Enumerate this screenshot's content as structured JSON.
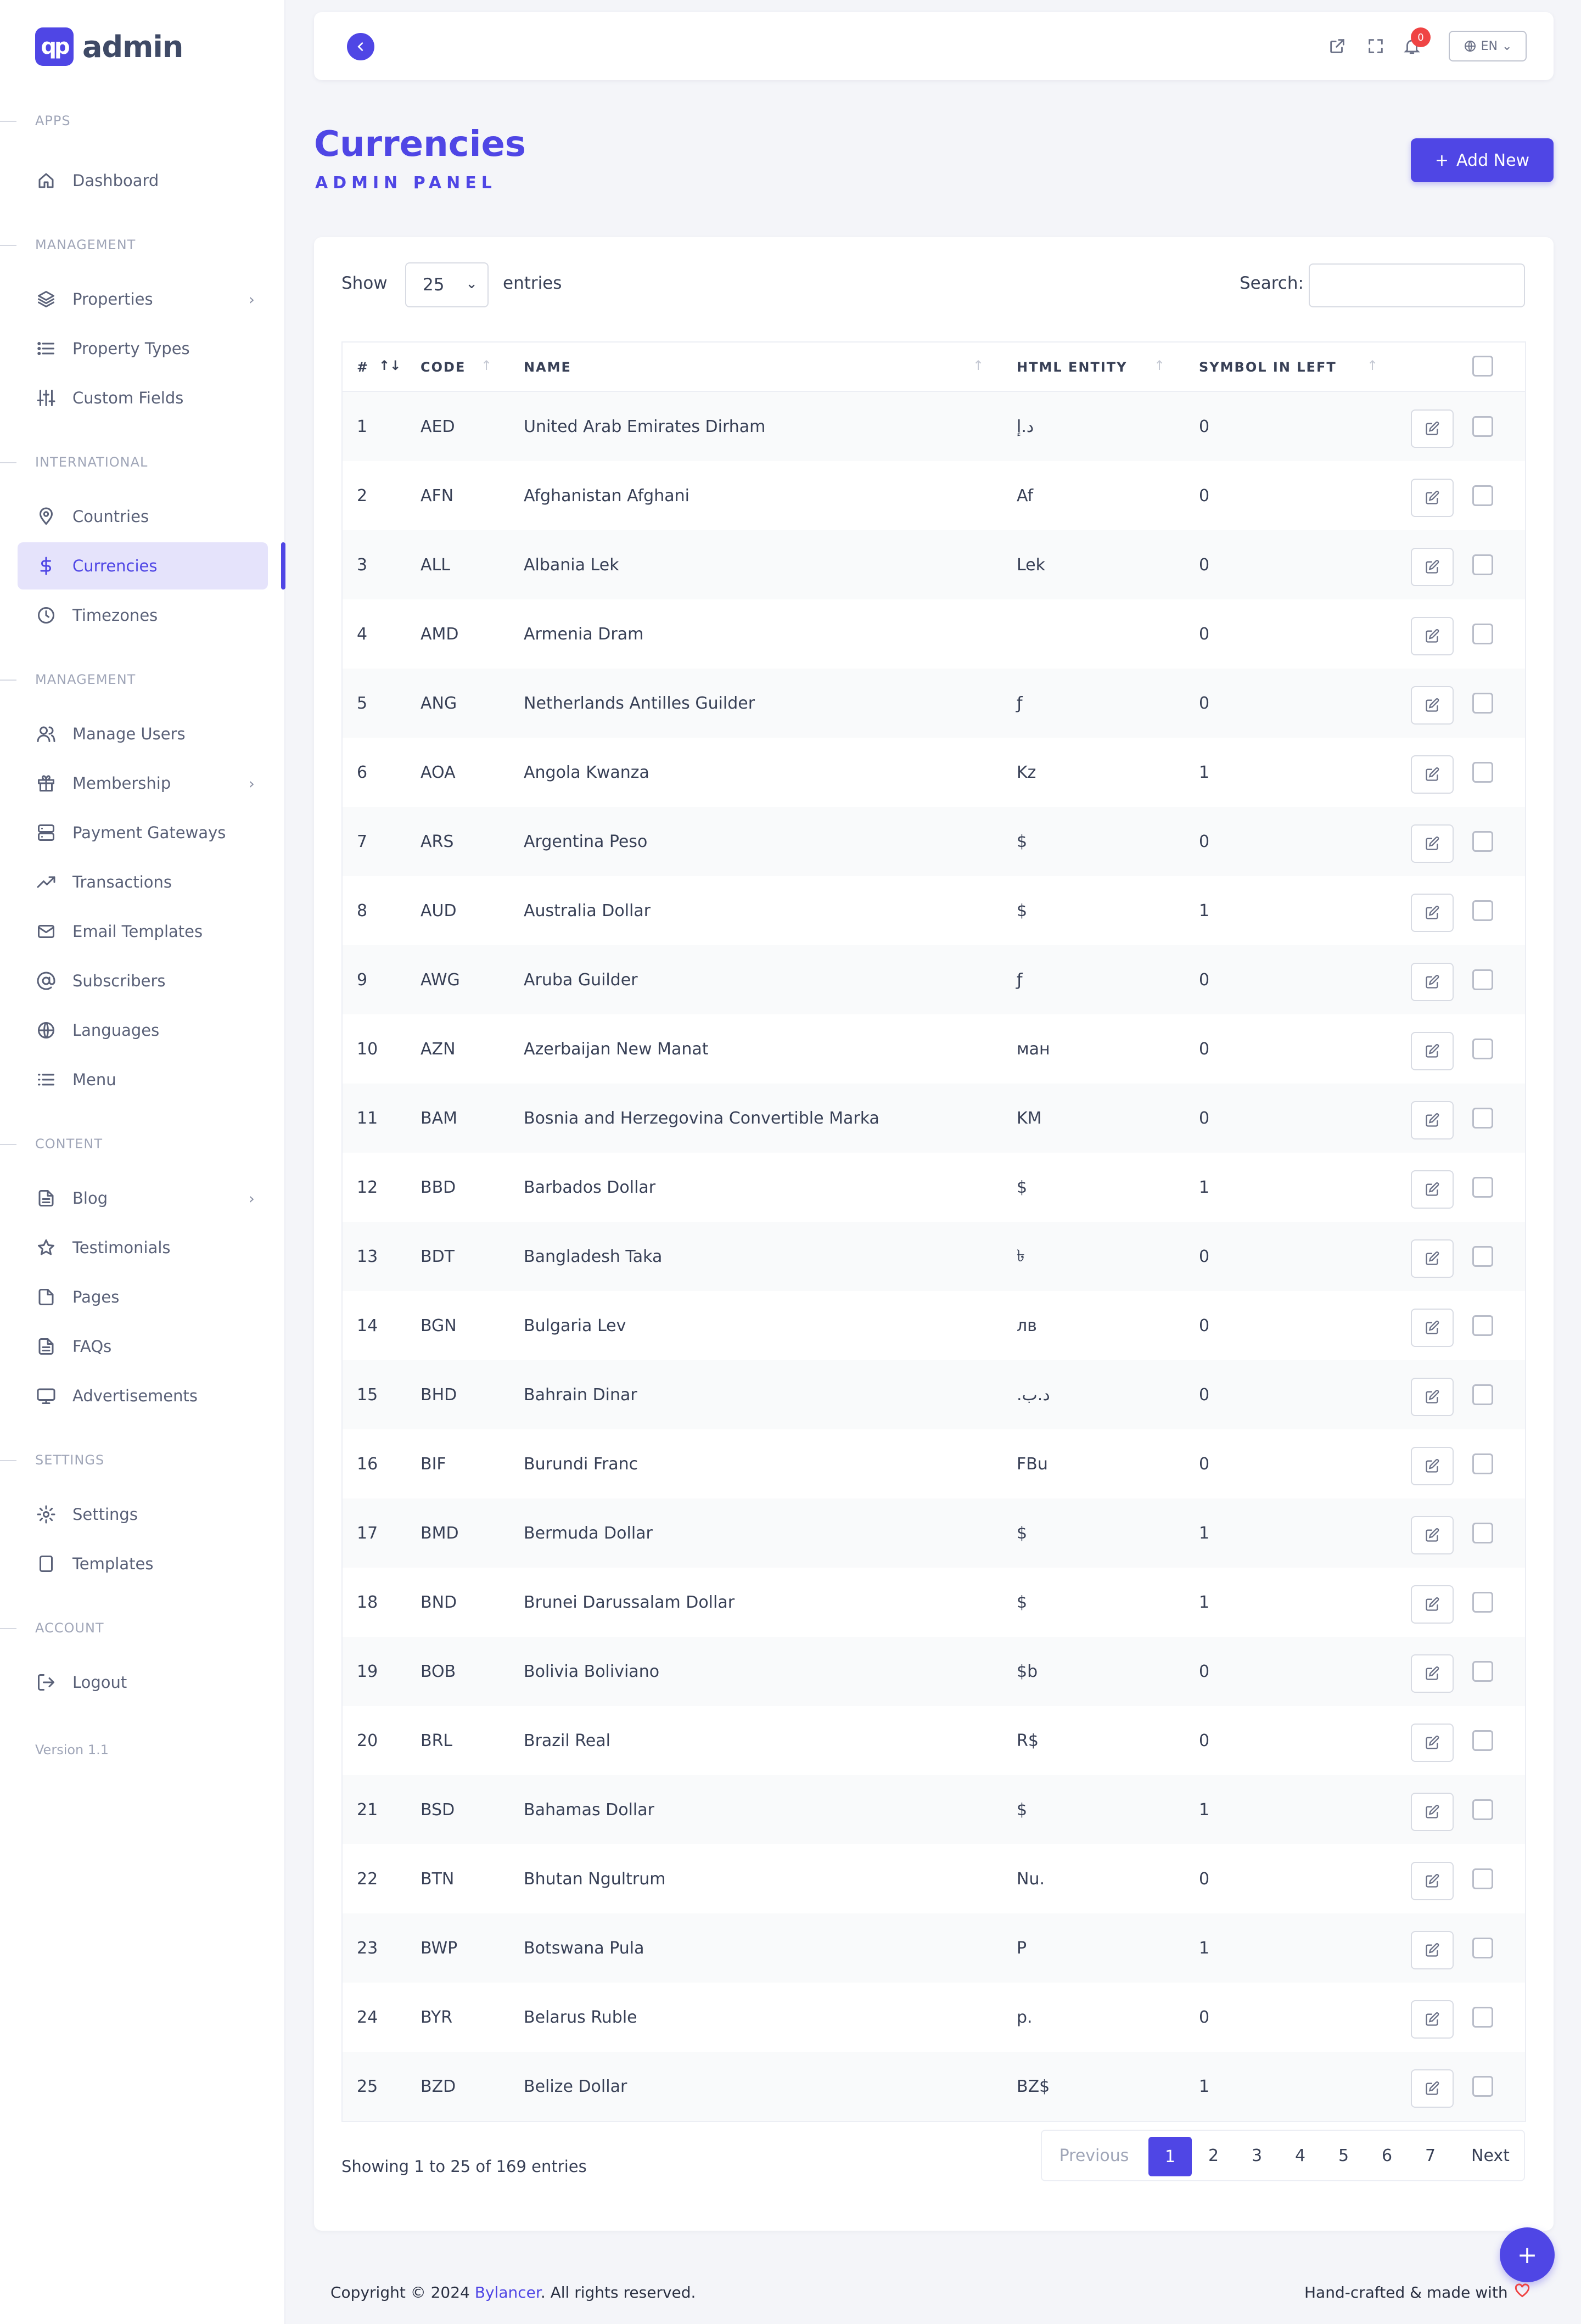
{
  "brand": {
    "logo_text": "qp",
    "name": "admin"
  },
  "sidebar": {
    "sections": [
      {
        "label": "APPS",
        "items": [
          {
            "label": "Dashboard",
            "icon": "home-icon"
          }
        ]
      },
      {
        "label": "MANAGEMENT",
        "items": [
          {
            "label": "Properties",
            "icon": "layers-icon",
            "has_children": true
          },
          {
            "label": "Property Types",
            "icon": "list-icon"
          },
          {
            "label": "Custom Fields",
            "icon": "sliders-icon"
          }
        ]
      },
      {
        "label": "INTERNATIONAL",
        "items": [
          {
            "label": "Countries",
            "icon": "map-pin-icon"
          },
          {
            "label": "Currencies",
            "icon": "dollar-icon",
            "active": true
          },
          {
            "label": "Timezones",
            "icon": "clock-icon"
          }
        ]
      },
      {
        "label": "MANAGEMENT",
        "items": [
          {
            "label": "Manage Users",
            "icon": "users-icon"
          },
          {
            "label": "Membership",
            "icon": "gift-icon",
            "has_children": true
          },
          {
            "label": "Payment Gateways",
            "icon": "server-icon"
          },
          {
            "label": "Transactions",
            "icon": "trending-up-icon"
          },
          {
            "label": "Email Templates",
            "icon": "mail-icon"
          },
          {
            "label": "Subscribers",
            "icon": "at-sign-icon"
          },
          {
            "label": "Languages",
            "icon": "globe-icon"
          },
          {
            "label": "Menu",
            "icon": "menu-icon"
          }
        ]
      },
      {
        "label": "CONTENT",
        "items": [
          {
            "label": "Blog",
            "icon": "file-text-icon",
            "has_children": true
          },
          {
            "label": "Testimonials",
            "icon": "star-icon"
          },
          {
            "label": "Pages",
            "icon": "file-icon"
          },
          {
            "label": "FAQs",
            "icon": "file-text-icon"
          },
          {
            "label": "Advertisements",
            "icon": "monitor-icon"
          }
        ]
      },
      {
        "label": "SETTINGS",
        "items": [
          {
            "label": "Settings",
            "icon": "gear-icon"
          },
          {
            "label": "Templates",
            "icon": "tablet-icon"
          }
        ]
      },
      {
        "label": "ACCOUNT",
        "items": [
          {
            "label": "Logout",
            "icon": "log-out-icon"
          }
        ]
      }
    ],
    "version": "Version 1.1"
  },
  "topbar": {
    "notification_count": "0",
    "language": "EN"
  },
  "header": {
    "title": "Currencies",
    "subtitle": "ADMIN PANEL",
    "add_button": "Add New"
  },
  "table_controls": {
    "show_label": "Show",
    "page_length": "25",
    "entries_label": "entries",
    "search_label": "Search:",
    "search_value": ""
  },
  "table": {
    "columns": [
      "#",
      "CODE",
      "NAME",
      "HTML ENTITY",
      "SYMBOL IN LEFT"
    ],
    "rows": [
      [
        "1",
        "AED",
        "United Arab Emirates Dirham",
        "د.إ",
        "0"
      ],
      [
        "2",
        "AFN",
        "Afghanistan Afghani",
        "Af",
        "0"
      ],
      [
        "3",
        "ALL",
        "Albania Lek",
        "Lek",
        "0"
      ],
      [
        "4",
        "AMD",
        "Armenia Dram",
        "",
        "0"
      ],
      [
        "5",
        "ANG",
        "Netherlands Antilles Guilder",
        "ƒ",
        "0"
      ],
      [
        "6",
        "AOA",
        "Angola Kwanza",
        "Kz",
        "1"
      ],
      [
        "7",
        "ARS",
        "Argentina Peso",
        "$",
        "0"
      ],
      [
        "8",
        "AUD",
        "Australia Dollar",
        "$",
        "1"
      ],
      [
        "9",
        "AWG",
        "Aruba Guilder",
        "ƒ",
        "0"
      ],
      [
        "10",
        "AZN",
        "Azerbaijan New Manat",
        "ман",
        "0"
      ],
      [
        "11",
        "BAM",
        "Bosnia and Herzegovina Convertible Marka",
        "KM",
        "0"
      ],
      [
        "12",
        "BBD",
        "Barbados Dollar",
        "$",
        "1"
      ],
      [
        "13",
        "BDT",
        "Bangladesh Taka",
        "৳",
        "0"
      ],
      [
        "14",
        "BGN",
        "Bulgaria Lev",
        "лв",
        "0"
      ],
      [
        "15",
        "BHD",
        "Bahrain Dinar",
        ".د.ب",
        "0"
      ],
      [
        "16",
        "BIF",
        "Burundi Franc",
        "FBu",
        "0"
      ],
      [
        "17",
        "BMD",
        "Bermuda Dollar",
        "$",
        "1"
      ],
      [
        "18",
        "BND",
        "Brunei Darussalam Dollar",
        "$",
        "1"
      ],
      [
        "19",
        "BOB",
        "Bolivia Boliviano",
        "$b",
        "0"
      ],
      [
        "20",
        "BRL",
        "Brazil Real",
        "R$",
        "0"
      ],
      [
        "21",
        "BSD",
        "Bahamas Dollar",
        "$",
        "1"
      ],
      [
        "22",
        "BTN",
        "Bhutan Ngultrum",
        "Nu.",
        "0"
      ],
      [
        "23",
        "BWP",
        "Botswana Pula",
        "P",
        "1"
      ],
      [
        "24",
        "BYR",
        "Belarus Ruble",
        "p.",
        "0"
      ],
      [
        "25",
        "BZD",
        "Belize Dollar",
        "BZ$",
        "1"
      ]
    ]
  },
  "pagination": {
    "info": "Showing 1 to 25 of 169 entries",
    "previous": "Previous",
    "pages": [
      "1",
      "2",
      "3",
      "4",
      "5",
      "6",
      "7"
    ],
    "current": "1",
    "next": "Next"
  },
  "footer": {
    "copyright_prefix": "Copyright © 2024 ",
    "company": "Bylancer",
    "copyright_suffix": ". All rights reserved.",
    "made_with": "Hand-crafted & made with"
  },
  "colors": {
    "accent": "#4f46e5",
    "badge": "#ef4444"
  }
}
